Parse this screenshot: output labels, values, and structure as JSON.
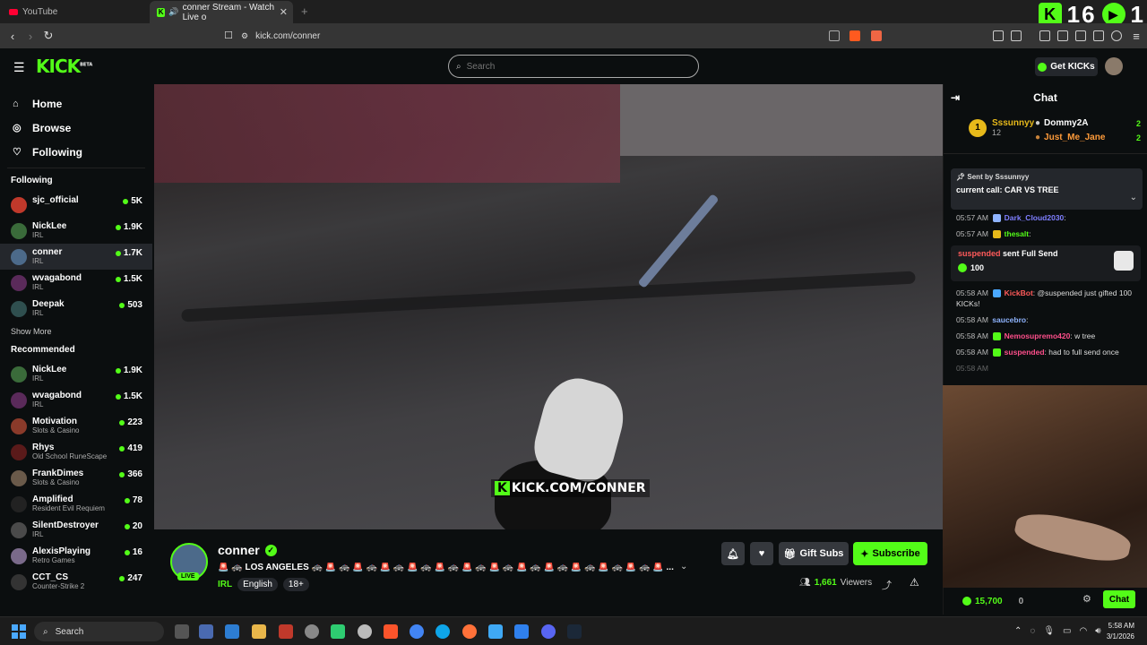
{
  "browser": {
    "tabs": [
      {
        "label": "YouTube"
      },
      {
        "label": "conner Stream - Watch Live o"
      }
    ],
    "url": "kick.com/conner"
  },
  "overlay_counter": {
    "left_value": "16",
    "right_value": "1"
  },
  "header": {
    "logo": "KICK",
    "logo_tag": "BETA",
    "search_placeholder": "Search",
    "get_kicks_label": "Get KICKs"
  },
  "sidebar": {
    "nav": [
      {
        "label": "Home",
        "icon": "home-icon"
      },
      {
        "label": "Browse",
        "icon": "compass-icon"
      },
      {
        "label": "Following",
        "icon": "heart-icon"
      }
    ],
    "following_title": "Following",
    "following": [
      {
        "name": "sjc_official",
        "category": "",
        "viewers": "5K",
        "color": "#c0392b"
      },
      {
        "name": "NickLee",
        "category": "IRL",
        "viewers": "1.9K",
        "color": "#3a6b3a"
      },
      {
        "name": "conner",
        "category": "IRL",
        "viewers": "1.7K",
        "color": "#4c6a8a"
      },
      {
        "name": "wvagabond",
        "category": "IRL",
        "viewers": "1.5K",
        "color": "#5a2a5a"
      },
      {
        "name": "Deepak",
        "category": "IRL",
        "viewers": "503",
        "color": "#2f4f4f"
      }
    ],
    "show_more_label": "Show More",
    "recommended_title": "Recommended",
    "recommended": [
      {
        "name": "NickLee",
        "category": "IRL",
        "viewers": "1.9K",
        "color": "#3a6b3a"
      },
      {
        "name": "wvagabond",
        "category": "IRL",
        "viewers": "1.5K",
        "color": "#5a2a5a"
      },
      {
        "name": "Motivation",
        "category": "Slots & Casino",
        "viewers": "223",
        "color": "#8a3a2a"
      },
      {
        "name": "Rhys",
        "category": "Old School RuneScape",
        "viewers": "419",
        "color": "#5a1a1a"
      },
      {
        "name": "FrankDimes",
        "category": "Slots & Casino",
        "viewers": "366",
        "color": "#6a5a4a"
      },
      {
        "name": "Amplified",
        "category": "Resident Evil Requiem",
        "viewers": "78",
        "color": "#222222"
      },
      {
        "name": "SilentDestroyer",
        "category": "IRL",
        "viewers": "20",
        "color": "#4a4a4a"
      },
      {
        "name": "AlexisPlaying",
        "category": "Retro Games",
        "viewers": "16",
        "color": "#7a6a8a"
      },
      {
        "name": "CCT_CS",
        "category": "Counter-Strike 2",
        "viewers": "247",
        "color": "#333333"
      }
    ]
  },
  "video": {
    "watermark": "KICK.COM/CONNER"
  },
  "stream": {
    "name": "conner",
    "live_label": "LIVE",
    "title": "🚨 🚓 LOS ANGELES 🚓 🚨 🚓 🚨 🚓 🚨 🚓 🚨 🚓 🚨 🚓 🚨 🚓 🚨 🚓 🚨 🚓 🚨 🚓 🚨 🚓 🚨 🚓 🚨 🚓 🚨 ...",
    "category": "IRL",
    "tags": [
      "English",
      "18+"
    ],
    "gift_subs_label": "Gift Subs",
    "subscribe_label": "Subscribe",
    "viewers_count": "1,661",
    "viewers_label": "Viewers"
  },
  "chat": {
    "title": "Chat",
    "leaderboard": {
      "first": {
        "rank": "1",
        "name": "Sssunnyy",
        "count": "12"
      },
      "second": {
        "name": "Dommy2A",
        "count": "2"
      },
      "third": {
        "name": "Just_Me_Jane",
        "count": "2"
      }
    },
    "pinned": {
      "sent_by_label": "Sent by",
      "sender": "Sssunnyy",
      "text": "current call: CAR VS TREE"
    },
    "messages": [
      {
        "time": "05:57 AM",
        "user": "Dark_Cloud2030",
        "text": ""
      },
      {
        "time": "05:57 AM",
        "user": "thesalt",
        "text": ""
      }
    ],
    "gift": {
      "user": "suspended",
      "action": "sent Full Send",
      "amount": "100"
    },
    "messages2": [
      {
        "time": "05:58 AM",
        "user": "KickBot",
        "text": ": @suspended just gifted 100 KICKs!"
      },
      {
        "time": "05:58 AM",
        "user": "saucebro",
        "text": ":"
      },
      {
        "time": "05:58 AM",
        "user": "Nemosupremo420",
        "text": ": w tree"
      },
      {
        "time": "05:58 AM",
        "user": "suspended",
        "text": ": had to full send once"
      },
      {
        "time": "05:58 AM",
        "user": "",
        "text": ""
      }
    ],
    "bottom_kicks": "15,700",
    "bottom_zero": "0",
    "chat_button": "Chat"
  },
  "taskbar": {
    "search_label": "Search",
    "time": "5:58 AM",
    "date": "3/1/2026"
  }
}
